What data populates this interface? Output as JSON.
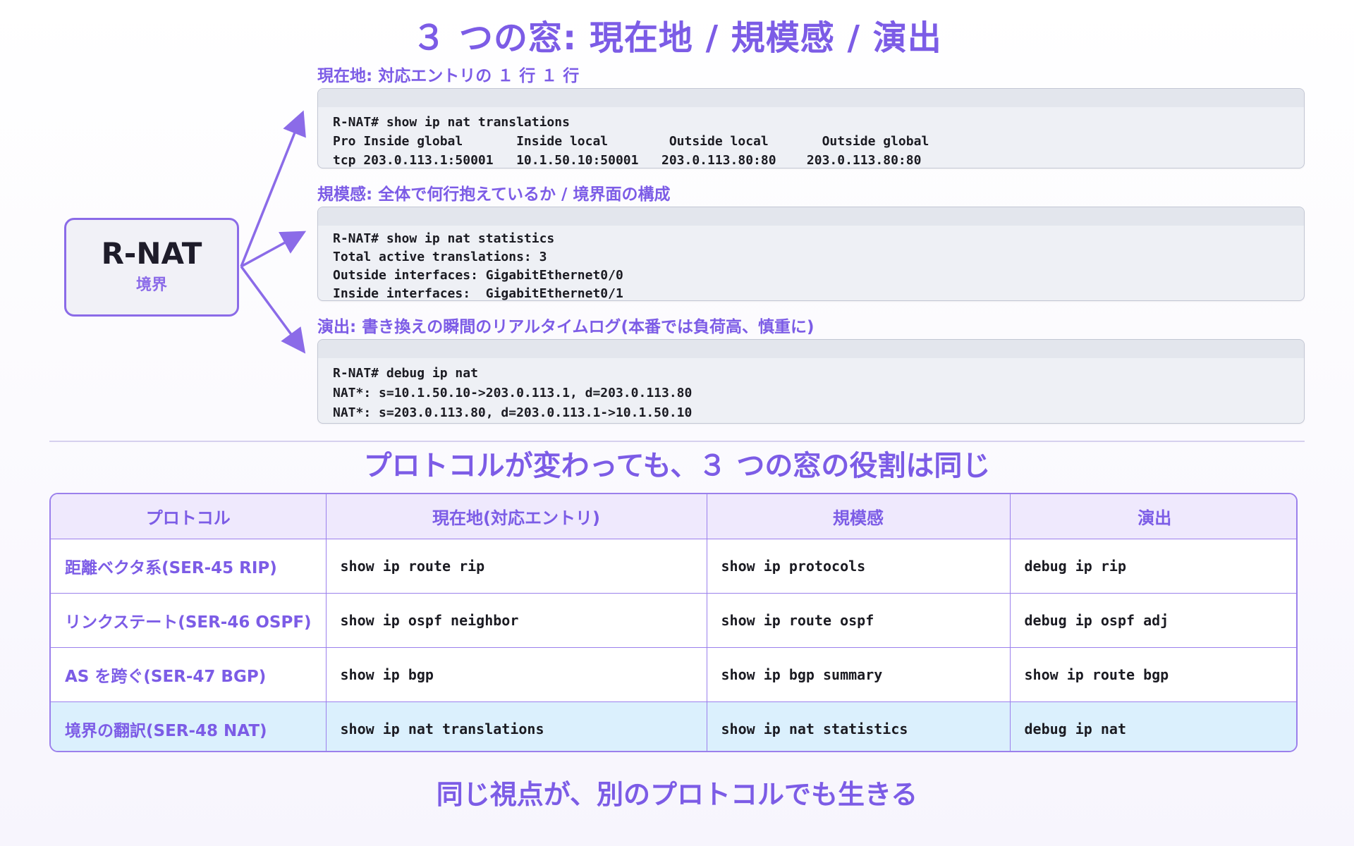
{
  "title": "３ つの窓: 現在地 / 規模感 / 演出",
  "router": {
    "name": "R-NAT",
    "role": "境界"
  },
  "windows": [
    {
      "label": "現在地: 対応エントリの １ 行 １ 行",
      "lines": [
        "R-NAT# show ip nat translations",
        "Pro Inside global       Inside local        Outside local       Outside global",
        "tcp 203.0.113.1:50001   10.1.50.10:50001   203.0.113.80:80    203.0.113.80:80"
      ]
    },
    {
      "label": "規模感: 全体で何行抱えているか / 境界面の構成",
      "lines": [
        "R-NAT# show ip nat statistics",
        "Total active translations: 3",
        "Outside interfaces: GigabitEthernet0/0",
        "Inside interfaces:  GigabitEthernet0/1"
      ]
    },
    {
      "label": "演出: 書き換えの瞬間のリアルタイムログ(本番では負荷高、慎重に)",
      "lines": [
        "R-NAT# debug ip nat",
        "NAT*: s=10.1.50.10->203.0.113.1, d=203.0.113.80",
        "NAT*: s=203.0.113.80, d=203.0.113.1->10.1.50.10"
      ]
    }
  ],
  "table_title": "プロトコルが変わっても、３ つの窓の役割は同じ",
  "table": {
    "headers": [
      "プロトコル",
      "現在地(対応エントリ)",
      "規模感",
      "演出"
    ],
    "rows": [
      [
        "距離ベクタ系(SER-45 RIP)",
        "show ip route rip",
        "show ip protocols",
        "debug ip rip"
      ],
      [
        "リンクステート(SER-46 OSPF)",
        "show ip ospf neighbor",
        "show ip route ospf",
        "debug ip ospf adj"
      ],
      [
        "AS を跨ぐ(SER-47 BGP)",
        "show ip bgp",
        "show ip bgp summary",
        "show ip route bgp"
      ],
      [
        "境界の翻訳(SER-48 NAT)",
        "show ip nat translations",
        "show ip nat statistics",
        "debug ip nat"
      ]
    ]
  },
  "footer": "同じ視点が、別のプロトコルでも生きる",
  "colors": {
    "accent": "#7c5ce6",
    "border": "#9b80ec",
    "terminal_bg": "#eef0f5",
    "header_bg": "#efe9fd",
    "highlight_row": "#dbf0fd"
  }
}
